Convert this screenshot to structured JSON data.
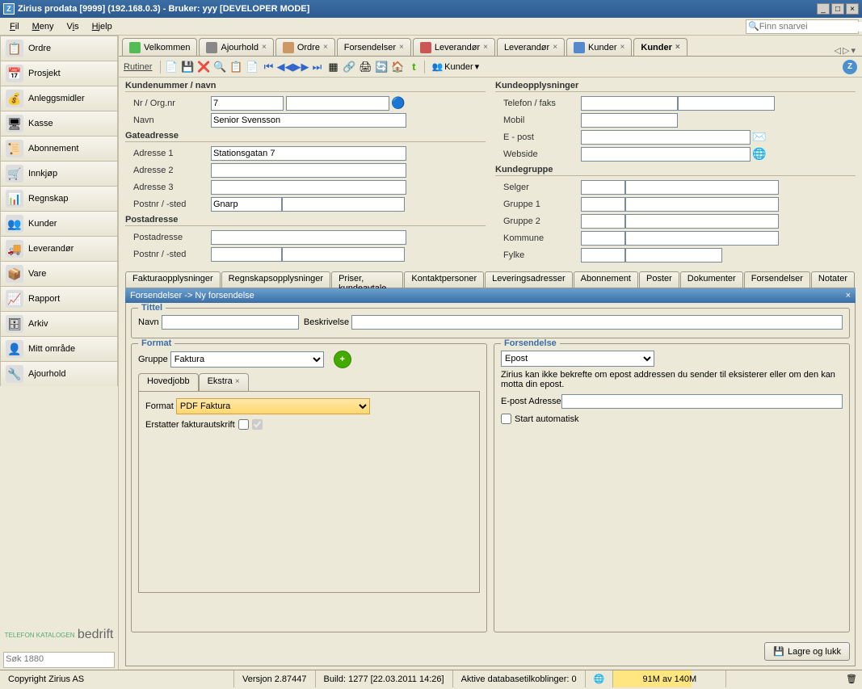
{
  "titlebar": "Zirius prodata [9999] (192.168.0.3)  - Bruker: yyy [DEVELOPER MODE]",
  "menu": {
    "fil": "Fil",
    "meny": "Meny",
    "vis": "Vis",
    "hjelp": "Hjelp"
  },
  "search_placeholder": "Finn snarvei",
  "sidebar": {
    "items": [
      {
        "label": "Ordre"
      },
      {
        "label": "Prosjekt"
      },
      {
        "label": "Anleggsmidler"
      },
      {
        "label": "Kasse"
      },
      {
        "label": "Abonnement"
      },
      {
        "label": "Innkjøp"
      },
      {
        "label": "Regnskap"
      },
      {
        "label": "Kunder"
      },
      {
        "label": "Leverandør"
      },
      {
        "label": "Vare"
      },
      {
        "label": "Rapport"
      },
      {
        "label": "Arkiv"
      },
      {
        "label": "Mitt område"
      },
      {
        "label": "Ajourhold"
      }
    ],
    "logo1": "TELEFON KATALOGEN",
    "logo2": "bedrift",
    "sok_placeholder": "Søk 1880"
  },
  "tabs": [
    {
      "label": "Velkommen",
      "close": false
    },
    {
      "label": "Ajourhold",
      "close": true
    },
    {
      "label": "Ordre",
      "close": true
    },
    {
      "label": "Forsendelser",
      "close": true
    },
    {
      "label": "Leverandør",
      "close": true
    },
    {
      "label": "Leverandør",
      "close": true
    },
    {
      "label": "Kunder",
      "close": true
    },
    {
      "label": "Kunder",
      "close": true,
      "active": true
    }
  ],
  "toolbar": {
    "rutiner": "Rutiner",
    "kunder": "Kunder"
  },
  "form": {
    "kundenr_navn": "Kundenummer / navn",
    "nr_org": "Nr / Org.nr",
    "nr_val": "7",
    "navn": "Navn",
    "navn_val": "Senior Svensson",
    "gateadresse": "Gateadresse",
    "adr1": "Adresse 1",
    "adr1_val": "Stationsgatan 7",
    "adr2": "Adresse 2",
    "adr3": "Adresse 3",
    "postnr": "Postnr / -sted",
    "postnr_val": "Gnarp",
    "postadresse_h": "Postadresse",
    "postadresse": "Postadresse",
    "kundeopp": "Kundeopplysninger",
    "tel": "Telefon / faks",
    "mobil": "Mobil",
    "epost": "E - post",
    "web": "Webside",
    "kgruppe": "Kundegruppe",
    "selger": "Selger",
    "g1": "Gruppe 1",
    "g2": "Gruppe 2",
    "kommune": "Kommune",
    "fylke": "Fylke"
  },
  "subtabs": [
    "Fakturaopplysninger",
    "Regnskapsopplysninger",
    "Priser, kundeavtale",
    "Kontaktpersoner",
    "Leveringsadresser",
    "Abonnement",
    "Poster",
    "Dokumenter",
    "Forsendelser",
    "Notater"
  ],
  "panel": {
    "header": "Forsendelser -> Ny forsendelse",
    "tittel": "Tittel",
    "navn": "Navn",
    "besk": "Beskrivelse",
    "format": "Format",
    "gruppe": "Gruppe",
    "gruppe_val": "Faktura",
    "hovedjobb": "Hovedjobb",
    "ekstra": "Ekstra",
    "format_lbl": "Format",
    "format_val": "PDF Faktura",
    "erstatter": "Erstatter fakturautskrift",
    "forsendelse": "Forsendelse",
    "fors_val": "Epost",
    "fors_note": "Zirius kan ikke bekrefte om epost addressen du sender til eksisterer eller om den kan motta din epost.",
    "epost_adr": "E-post Adresse",
    "start_auto": "Start automatisk",
    "save": "Lagre og lukk"
  },
  "status": {
    "copy": "Copyright Zirius AS",
    "ver": "Versjon 2.87447",
    "build": "Build: 1277 [22.03.2011 14:26]",
    "db": "Aktive databasetilkoblinger: 0",
    "mem": "91M av 140M"
  }
}
